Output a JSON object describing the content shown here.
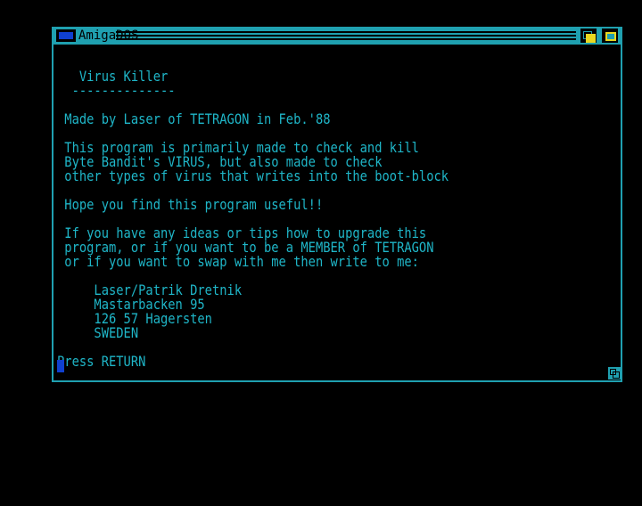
{
  "window": {
    "title": "AmigaDOS"
  },
  "console": {
    "lines": [
      "",
      "   Virus Killer",
      "  --------------",
      "",
      " Made by Laser of TETRAGON in Feb.'88",
      "",
      " This program is primarily made to check and kill",
      " Byte Bandit's VIRUS, but also made to check",
      " other types of virus that writes into the boot-block",
      "",
      " Hope you find this program useful!!",
      "",
      " If you have any ideas or tips how to upgrade this",
      " program, or if you want to be a MEMBER of TETRAGON",
      " or if you want to swap with me then write to me:",
      "",
      "     Laser/Patrik Dretnik",
      "     Mastarbacken 95",
      "     126 57 Hagersten",
      "     SWEDEN",
      "",
      "Press RETURN"
    ]
  },
  "colors": {
    "frame": "#1fa0b0",
    "text": "#1fb6c8",
    "cursor": "#1040d0",
    "gadget_accent": "#e8d820",
    "background": "#000000"
  },
  "icons": {
    "close": "close-icon",
    "depth_back": "depth-back-icon",
    "depth_front": "depth-front-icon",
    "resize": "resize-icon"
  }
}
